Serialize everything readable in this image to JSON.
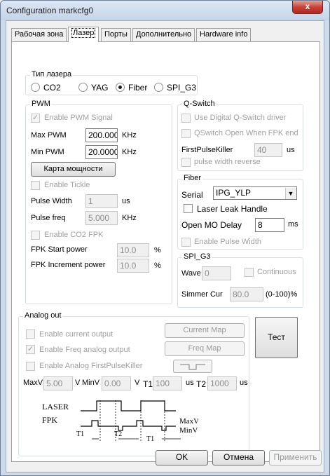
{
  "window": {
    "title": "Configuration markcfg0",
    "close_label": "x"
  },
  "tabs": [
    "Рабочая зона",
    "Лазер",
    "Порты",
    "Дополнительно",
    "Hardware info"
  ],
  "laser_type": {
    "legend": "Тип лазера",
    "options": [
      "CO2",
      "YAG",
      "Fiber",
      "SPI_G3"
    ],
    "selected": "Fiber"
  },
  "pwm": {
    "legend": "PWM",
    "enable_pwm_label": "Enable PWM Signal",
    "max_pwm_label": "Max PWM",
    "max_pwm_value": "200.000",
    "max_pwm_unit": "KHz",
    "min_pwm_label": "Min PWM",
    "min_pwm_value": "20.0000",
    "min_pwm_unit": "KHz",
    "power_map_button": "Карта мощности",
    "enable_tickle_label": "Enable Tickle",
    "pulse_width_label": "Pulse Width",
    "pulse_width_value": "1",
    "pulse_width_unit": "us",
    "pulse_freq_label": "Pulse freq",
    "pulse_freq_value": "5.000",
    "pulse_freq_unit": "KHz",
    "enable_co2_fpk_label": "Enable CO2 FPK",
    "fpk_start_label": "FPK Start power",
    "fpk_start_value": "10.0",
    "fpk_start_unit": "%",
    "fpk_inc_label": "FPK Increment power",
    "fpk_inc_value": "10.0",
    "fpk_inc_unit": "%"
  },
  "qswitch": {
    "legend": "Q-Switch",
    "digital_label": "Use Digital Q-Switch driver",
    "open_label": "QSwitch Open When FPK end",
    "fpk_label": "FirstPulseKiller",
    "fpk_value": "40",
    "fpk_unit": "us",
    "reverse_label": "pulse width reverse"
  },
  "fiber": {
    "legend": "Fiber",
    "serial_label": "Serial",
    "serial_value": "IPG_YLP",
    "leak_label": "Laser Leak Handle",
    "mo_delay_label": "Open MO Delay",
    "mo_delay_value": "8",
    "mo_delay_unit": "ms",
    "pulse_width_label": "Enable Pulse Width"
  },
  "spi": {
    "legend": "SPI_G3",
    "wave_label": "Wave",
    "wave_value": "0",
    "continuous_label": "Continuous",
    "simmer_label": "Simmer Cur",
    "simmer_value": "80.0",
    "simmer_unit": "(0-100)%"
  },
  "analog": {
    "legend": "Analog out",
    "current_label": "Enable current output",
    "freq_label": "Enable Freq analog output",
    "fpk_label": "Enable Analog FirstPulseKiller",
    "current_map_button": "Current Map",
    "freq_map_button": "Freq Map",
    "maxv_label": "MaxV",
    "maxv_value": "5.00",
    "maxv_unit": "V",
    "minv_label": "MinV",
    "minv_value": "0.00",
    "minv_unit": "V",
    "t1_label": "T1",
    "t1_value": "100",
    "t1_unit": "us",
    "t2_label": "T2",
    "t2_value": "1000",
    "t2_unit": "us",
    "diagram": {
      "laser": "LASER",
      "fpk": "FPK",
      "maxv": "MaxV",
      "minv": "MinV",
      "t1": "T1",
      "t2": "T2"
    }
  },
  "test_button": "Тест",
  "footer": {
    "ok": "OK",
    "cancel": "Отмена",
    "apply": "Применить"
  }
}
